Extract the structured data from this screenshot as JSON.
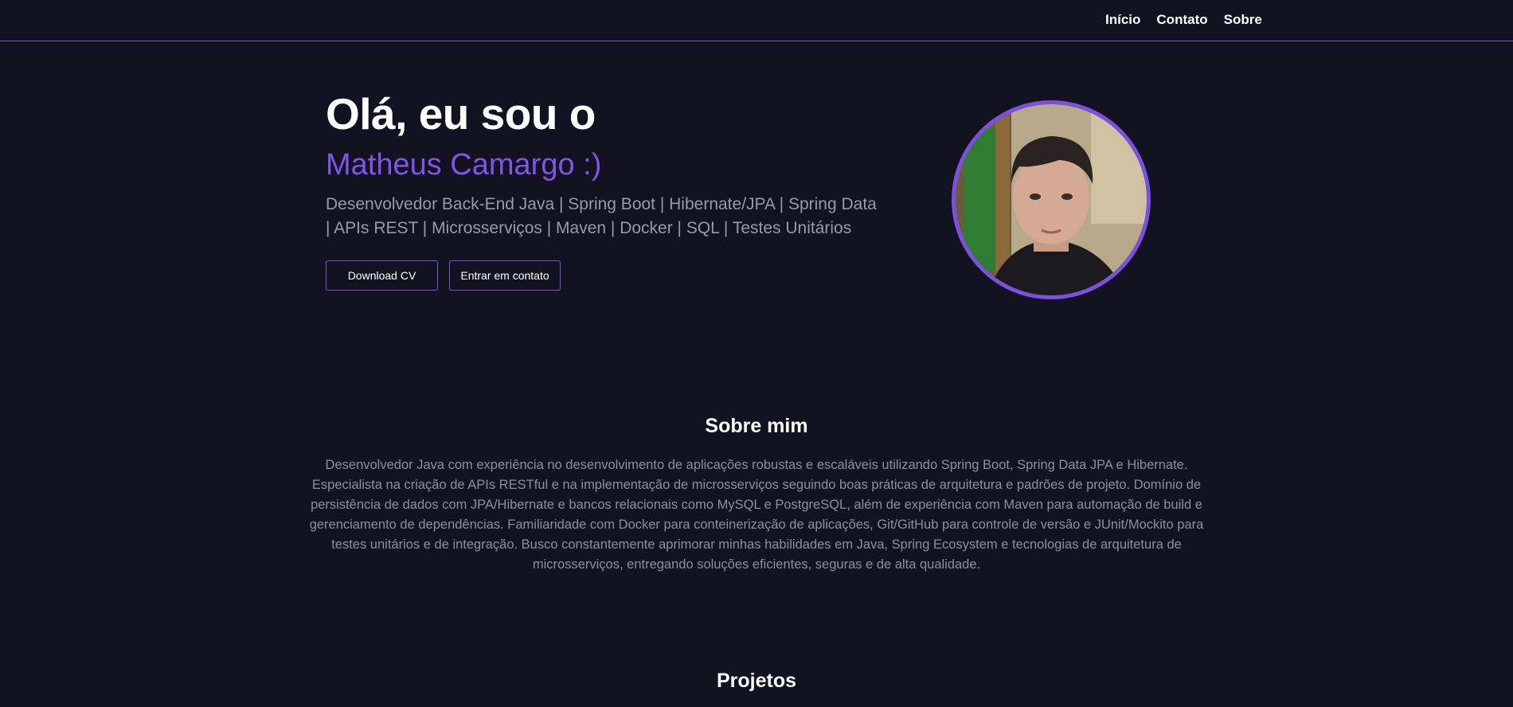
{
  "nav": {
    "items": [
      {
        "label": "Início"
      },
      {
        "label": "Contato"
      },
      {
        "label": "Sobre"
      }
    ]
  },
  "hero": {
    "greeting": "Olá, eu sou o",
    "name": "Matheus Camargo :)",
    "subtitle": "Desenvolvedor Back-End Java | Spring Boot | Hibernate/JPA | Spring Data | APIs REST | Microsserviços | Maven | Docker | SQL | Testes Unitários",
    "buttons": {
      "download_cv": "Download CV",
      "contact": "Entrar em contato"
    }
  },
  "about": {
    "title": "Sobre mim",
    "text": "Desenvolvedor Java com experiência no desenvolvimento de aplicações robustas e escaláveis utilizando Spring Boot, Spring Data JPA e Hibernate. Especialista na criação de APIs RESTful e na implementação de microsserviços seguindo boas práticas de arquitetura e padrões de projeto. Domínio de persistência de dados com JPA/Hibernate e bancos relacionais como MySQL e PostgreSQL, além de experiência com Maven para automação de build e gerenciamento de dependências. Familiaridade com Docker para conteinerização de aplicações, Git/GitHub para controle de versão e JUnit/Mockito para testes unitários e de integração. Busco constantemente aprimorar minhas habilidades em Java, Spring Ecosystem e tecnologias de arquitetura de microsserviços, entregando soluções eficientes, seguras e de alta qualidade."
  },
  "projects": {
    "title": "Projetos"
  },
  "colors": {
    "background": "#121220",
    "accent": "#7b4fe0",
    "name": "#7f55e8",
    "muted_text": "#9a9aa6"
  }
}
